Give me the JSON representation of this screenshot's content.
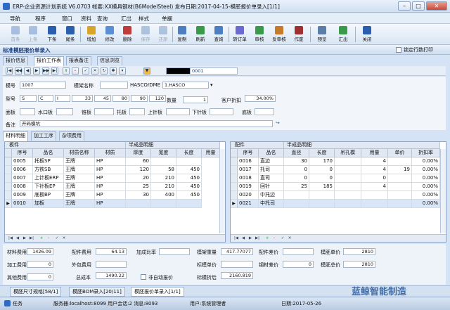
{
  "window": {
    "title": "ERP-企业资源计划系统 V6.0703 帐套:XX模具钢材(B6ModelSteel) 发布日期:2017-04-15-模胚报价单录入[1/1]",
    "min": "–",
    "max": "□",
    "close": "✕"
  },
  "menu": [
    "导航",
    "程序",
    "窗口",
    "资料",
    "查询",
    "汇出",
    "样式",
    "单据"
  ],
  "toolbar": [
    "首条",
    "上条",
    "下条",
    "尾条",
    "增加",
    "修改",
    "删除",
    "保存",
    "还原",
    "复制",
    "刷新",
    "查询",
    "转订单",
    "审核",
    "反审核",
    "作废",
    "预览",
    "汇出",
    "关闭"
  ],
  "section": {
    "title": "标准模胚报价单录入",
    "lock_label": "锁定行数打印"
  },
  "main_tabs": [
    "报价信息",
    "报价工作表",
    "报表备注",
    "信息浏览"
  ],
  "form": {
    "record_no": "0001",
    "labels": {
      "mold_no": "模号",
      "frame_name": "模架名称",
      "hasco": "HASCO/DME",
      "type": "型号",
      "qty": "数量",
      "customer_discount": "客户折扣",
      "panel": "面板",
      "water_plate": "水口板",
      "a_plate": "锥板",
      "support": "托板",
      "upper_needle": "上针板",
      "lower_needle": "下针板",
      "bottom": "底板",
      "remark": "备注"
    },
    "mold_no": "1007",
    "hasco": "1.HASCO",
    "type_values": [
      "S",
      "C",
      "I",
      "33",
      "45",
      "80",
      "90",
      "120"
    ],
    "qty": "1",
    "customer_discount": "34.00%",
    "remark": "开码模坑"
  },
  "sub_tabs": [
    "材料明细",
    "加工工序",
    "杂项费用"
  ],
  "left_grid": {
    "group_header": "板件",
    "sub_group": "半成品明细",
    "columns": [
      "序号",
      "品名",
      "材质名称",
      "材质",
      "厚度",
      "宽度",
      "长度",
      "用量"
    ],
    "rows": [
      [
        "0005",
        "托板SP",
        "王牌",
        "HP",
        "60",
        "",
        ""
      ],
      [
        "0006",
        "方铁SB",
        "王牌",
        "HP",
        "120",
        "58",
        "450"
      ],
      [
        "0007",
        "上针板ERP",
        "王牌",
        "HP",
        "20",
        "210",
        "450"
      ],
      [
        "0008",
        "下针板EP",
        "王牌",
        "HP",
        "25",
        "210",
        "450"
      ],
      [
        "0009",
        "底板BP",
        "王牌",
        "HP",
        "30",
        "400",
        "450"
      ],
      [
        "0010",
        "加板",
        "王牌",
        "HP",
        "",
        "",
        ""
      ]
    ]
  },
  "right_grid": {
    "group_header": "配件",
    "sub_group": "半成品明细",
    "columns": [
      "序号",
      "品名",
      "直径",
      "长度",
      "吊孔模",
      "用量",
      "单价",
      "折扣率"
    ],
    "rows": [
      [
        "0016",
        "直边",
        "30",
        "170",
        "",
        "4",
        "",
        "0.00%"
      ],
      [
        "0017",
        "托司",
        "0",
        "0",
        "",
        "4",
        "19",
        "0.00%"
      ],
      [
        "0018",
        "直司",
        "0",
        "0",
        "",
        "0",
        "",
        "0.00%"
      ],
      [
        "0019",
        "回针",
        "25",
        "185",
        "",
        "4",
        "",
        "0.00%"
      ],
      [
        "0020",
        "中托边",
        "",
        "",
        "",
        "",
        "",
        "0.00%"
      ],
      [
        "0021",
        "中托司",
        "",
        "",
        "",
        "",
        "",
        "0.00%"
      ]
    ]
  },
  "summary": {
    "labels": {
      "material_cost": "材料费用",
      "parts_cost": "配件费用",
      "process_markup": "加成比率",
      "frame_weight": "模架重量",
      "parts_diff": "配件差价",
      "frame_unit_price": "模胚单价",
      "process_cost": "加工费用",
      "outsourced_cost": "外包费用",
      "std_unit_price": "标模单价",
      "material_diff": "钢材差价",
      "frame_total": "模胚总价",
      "other_cost": "其他费用",
      "total_cost": "总成本",
      "non_auto_quote": "非自动报价",
      "std_discount": "标模折后"
    },
    "material_cost": "1426.09",
    "parts_cost": "64.13",
    "frame_weight": "417.77077",
    "frame_unit_price": "2810",
    "process_cost": "0",
    "material_diff": "0",
    "frame_total": "2810",
    "other_cost": "0",
    "total_cost": "1490.22",
    "std_discount": "2160.819"
  },
  "doc_tabs": [
    "模胚尺寸规格[58/1]",
    "模胚BOM录入[20/11]",
    "模胚报价单录入[1/1]"
  ],
  "statusbar": {
    "task": "任务",
    "server": "服务器:localhost:8099 用户会话:2 消息:8093",
    "user": "用户:系统管理者",
    "date": "日期:2017-05-26"
  },
  "watermark": "蓝鲸智能制造",
  "colors": {
    "accent": "#1b3e7a",
    "selected_row": "#d8e6f7",
    "header": "#dfe8f3"
  }
}
